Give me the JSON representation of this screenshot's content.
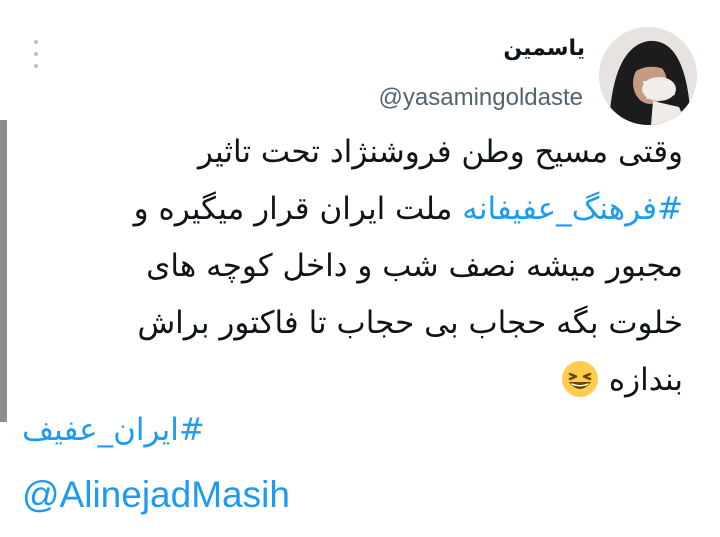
{
  "tweet": {
    "author": {
      "display_name": "یاسمین",
      "handle": "@yasamingoldaste",
      "avatar_icon": "profile-photo"
    },
    "menu_icon": "more-vertical-icon",
    "body_lines": [
      "وقتی مسیح وطن فروشنژاد تحت تاثیر",
      "ملت ایران قرار میگیره و",
      "مجبور میشه نصف شب و داخل کوچه های",
      "خلوت بگه حجاب بی حجاب تا فاکتور براش",
      "بندازه"
    ],
    "inline_hashtag": "#فرهنگ_عفیفانه",
    "emoji": "grinning-squinting-face",
    "hashtag": "#ایران_عفیف",
    "mention": "@AlinejadMasih"
  },
  "colors": {
    "link": "#1d9bf0",
    "text": "#0f1419",
    "secondary": "#536471",
    "left_edge": "#8e8e8e"
  }
}
